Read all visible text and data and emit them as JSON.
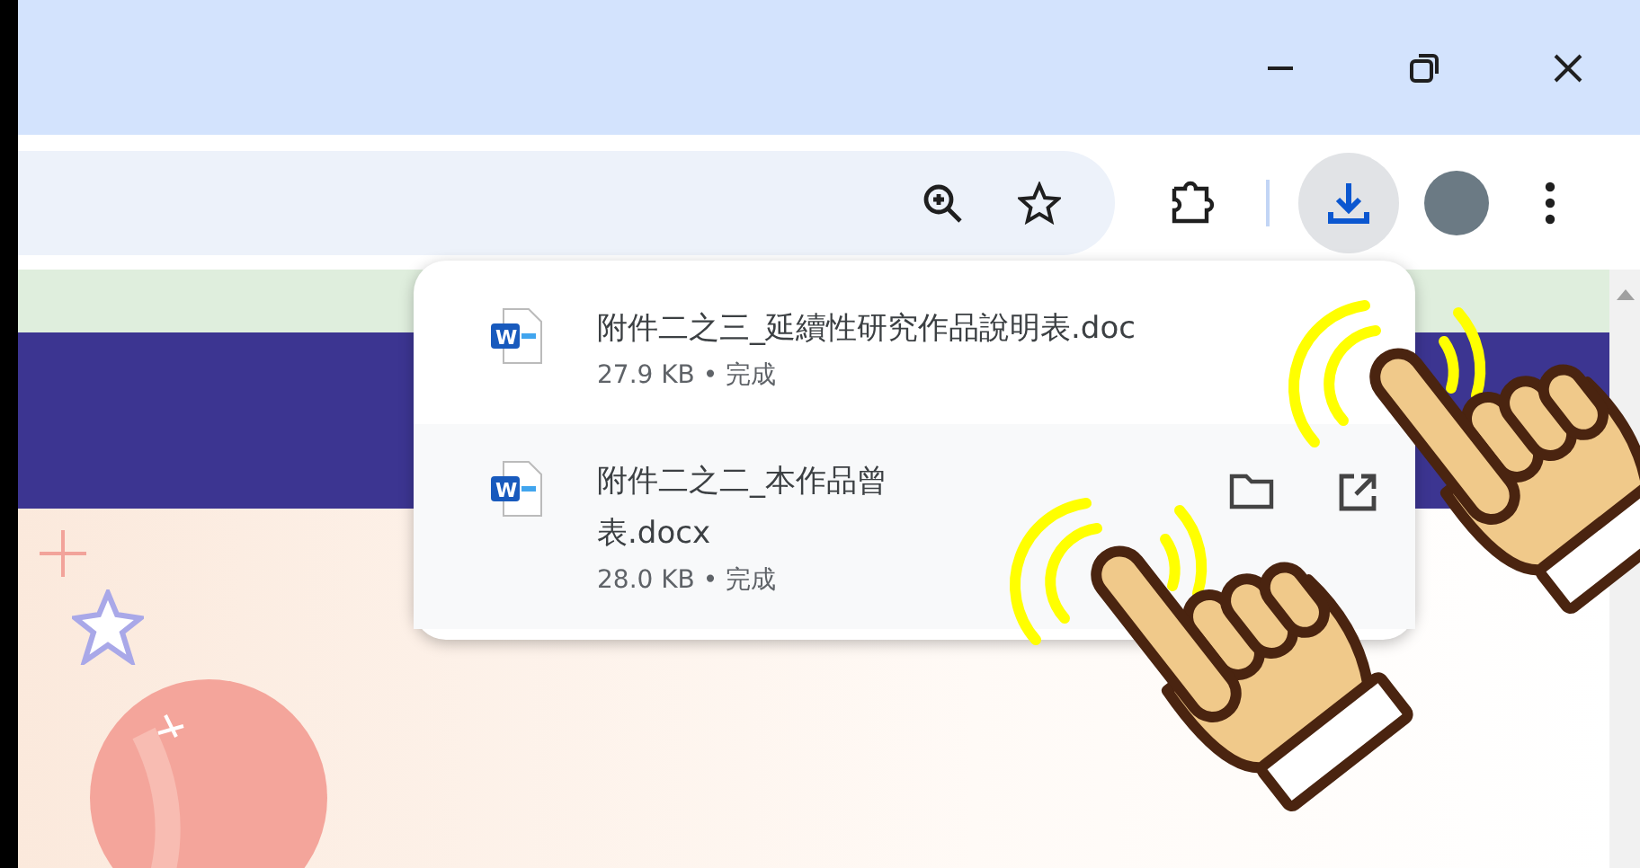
{
  "toolbar": {
    "downloads_open": true
  },
  "downloads": [
    {
      "icon_letter": "W",
      "name_lines": [
        "附件二之三_延續性研究作品說明表.doc"
      ],
      "status": "27.9 KB • 完成",
      "hovered": false
    },
    {
      "icon_letter": "W",
      "name_lines": [
        "附件二之二_本作品曾",
        "表.docx"
      ],
      "status": "28.0 KB • 完成",
      "hovered": true
    }
  ]
}
